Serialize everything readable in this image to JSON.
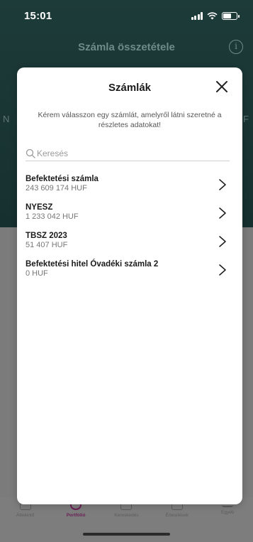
{
  "status_bar": {
    "time": "15:01"
  },
  "background": {
    "title": "Számla összetétele",
    "edge_left": "N",
    "edge_right": "F",
    "tabs": [
      {
        "label": "Áttekintő",
        "icon": "home-icon",
        "active": false
      },
      {
        "label": "Portfólió",
        "icon": "pie-chart-icon",
        "active": true
      },
      {
        "label": "Kereskedés",
        "icon": "trade-icon",
        "active": false
      },
      {
        "label": "Értesítések",
        "icon": "bell-icon",
        "active": false
      },
      {
        "label": "Egyéb",
        "icon": "menu-icon",
        "active": false
      }
    ]
  },
  "modal": {
    "title": "Számlák",
    "description": "Kérem válasszon egy számlát, amelyről látni szeretné a részletes adatokat!",
    "search": {
      "placeholder": "Keresés",
      "value": ""
    },
    "accounts": [
      {
        "name": "Befektetési számla",
        "amount": "243 609 174 HUF"
      },
      {
        "name": "NYESZ",
        "amount": "1 233 042 HUF"
      },
      {
        "name": "TBSZ 2023",
        "amount": "51 407 HUF"
      },
      {
        "name": "Befektetési hitel Óvadéki számla 2",
        "amount": "0 HUF"
      }
    ]
  },
  "colors": {
    "header_bg": "#1d3b39",
    "overlay": "#7b7b7b",
    "accent": "#6a1f55"
  }
}
